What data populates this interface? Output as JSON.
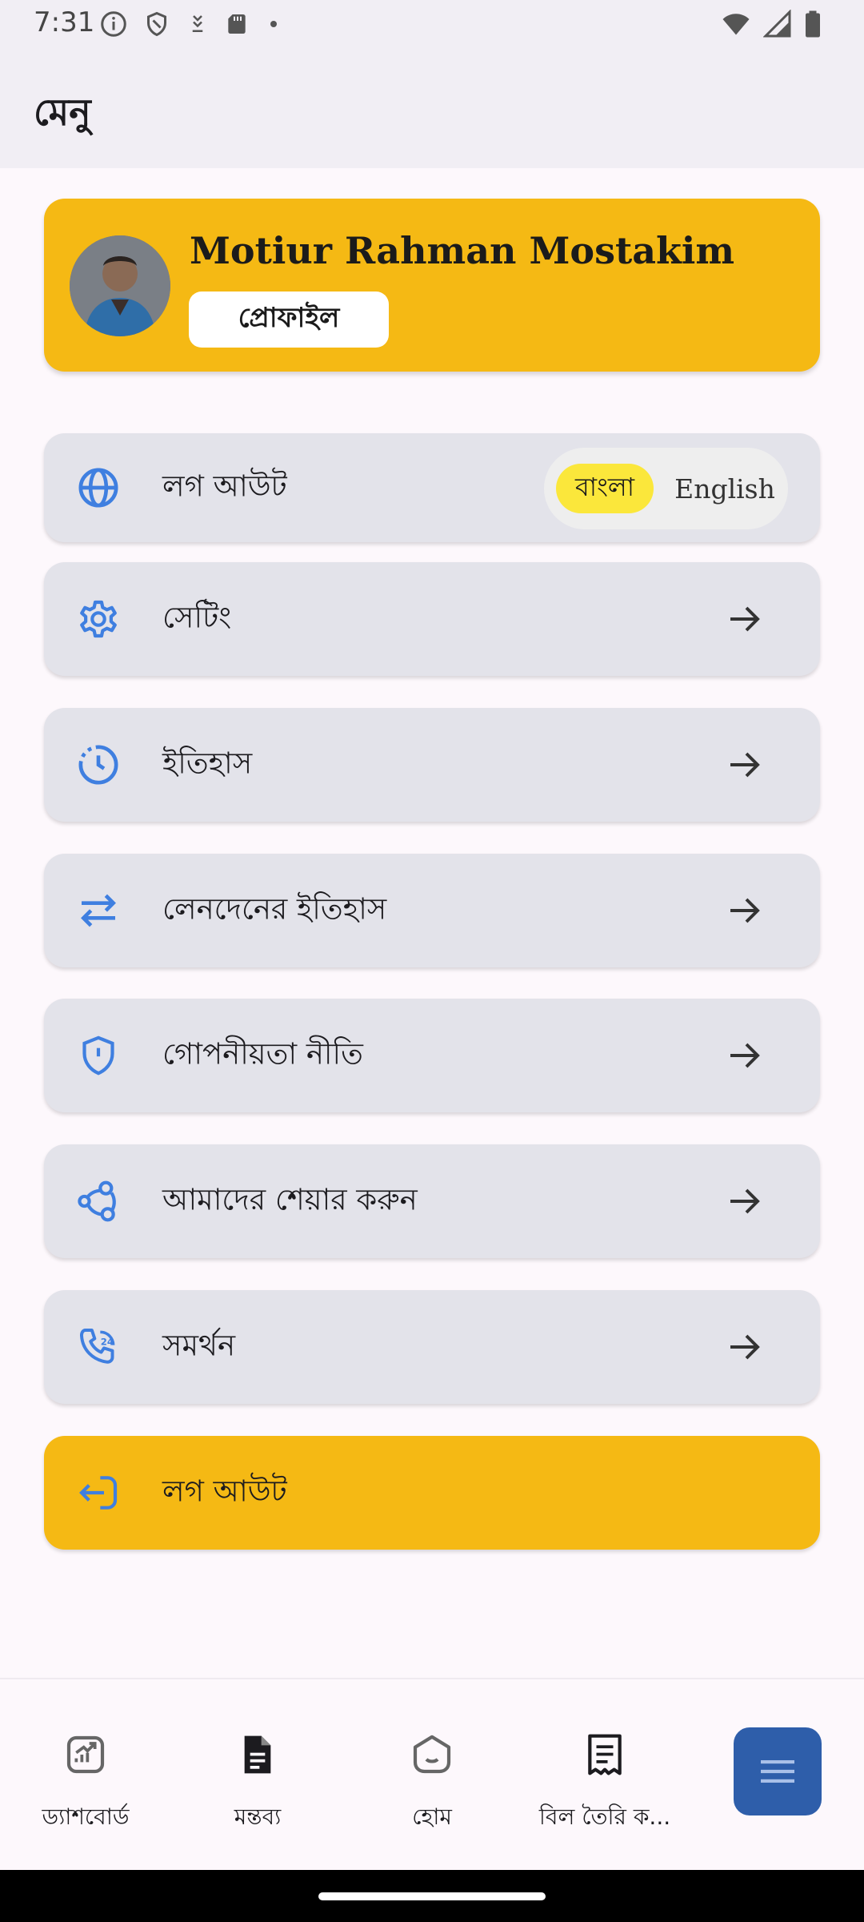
{
  "status_bar": {
    "time": "7:31",
    "left_icons": [
      "info-icon",
      "shield-icon",
      "download-icon",
      "sd-card-icon",
      "dot-icon"
    ],
    "right_icons": [
      "wifi-icon",
      "signal-icon",
      "battery-icon"
    ]
  },
  "app_bar": {
    "title": "মেনু"
  },
  "profile": {
    "name": "Motiur Rahman Mostakim",
    "button_label": "প্রোফাইল",
    "avatar_icon": "user-avatar"
  },
  "language": {
    "label": "লগ আউট",
    "icon": "globe-icon",
    "options": [
      "বাংলা",
      "English"
    ],
    "selected": "বাংলা"
  },
  "menu_items": [
    {
      "label": "সেটিং",
      "icon": "gear-icon"
    },
    {
      "label": "ইতিহাস",
      "icon": "history-icon"
    },
    {
      "label": "লেনদেনের ইতিহাস",
      "icon": "swap-arrows-icon"
    },
    {
      "label": "গোপনীয়তা নীতি",
      "icon": "privacy-shield-icon"
    },
    {
      "label": "আমাদের শেয়ার করুন",
      "icon": "share-icon"
    },
    {
      "label": "সমর্থন",
      "icon": "support-phone-icon"
    }
  ],
  "logout": {
    "label": "লগ আউট",
    "icon": "logout-icon"
  },
  "bottom_nav": [
    {
      "label": "ড্যাশবোর্ড",
      "icon": "dashboard-icon"
    },
    {
      "label": "মন্তব্য",
      "icon": "document-icon"
    },
    {
      "label": "হোম",
      "icon": "home-icon"
    },
    {
      "label": "বিল তৈরি ক...",
      "icon": "bill-icon"
    }
  ],
  "fab": {
    "icon": "menu-icon"
  },
  "colors": {
    "accent": "#F5B914",
    "card": "#E3E3EA",
    "icon_blue": "#3F7FE0",
    "lang_selected": "#FBE73B",
    "fab": "#2E5EAA"
  }
}
